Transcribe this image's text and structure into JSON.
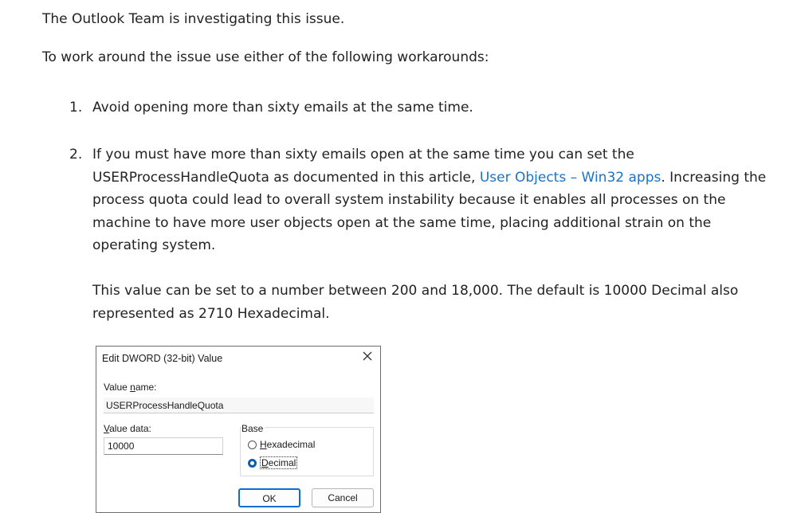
{
  "article": {
    "intro": "The Outlook Team is investigating this issue.",
    "workaround_intro": "To work around the issue use either of the following workarounds:",
    "steps": [
      {
        "number": "1.",
        "text": "Avoid opening more than sixty emails at the same time."
      },
      {
        "number": "2.",
        "text_before_link": "If you must have more than sixty emails open at the same time you can set the USERProcessHandleQuota as documented in this article, ",
        "link_text": "User Objects – Win32 apps",
        "text_after_link": ". Increasing the process quota could lead to overall system instability because it enables all processes on the machine to have more user objects open at the same time, placing additional strain on the operating system.",
        "extra": "This value can be set to a number between 200 and 18,000.  The default is 10000 Decimal also represented as 2710 Hexadecimal."
      }
    ],
    "link_color": "#1a73c6"
  },
  "dialog": {
    "title": "Edit DWORD (32-bit) Value",
    "value_name_label_pre": "Value ",
    "value_name_label_u": "n",
    "value_name_label_post": "ame:",
    "value_name": "USERProcessHandleQuota",
    "value_data_label_u": "V",
    "value_data_label_post": "alue data:",
    "value_data": "10000",
    "base_label": "Base",
    "hex_label_u": "H",
    "hex_label_post": "exadecimal",
    "dec_label_u": "D",
    "dec_label_post": "ecimal",
    "selected_base": "Decimal",
    "ok_label": "OK",
    "cancel_label": "Cancel",
    "accent_color": "#0a5fb5"
  }
}
